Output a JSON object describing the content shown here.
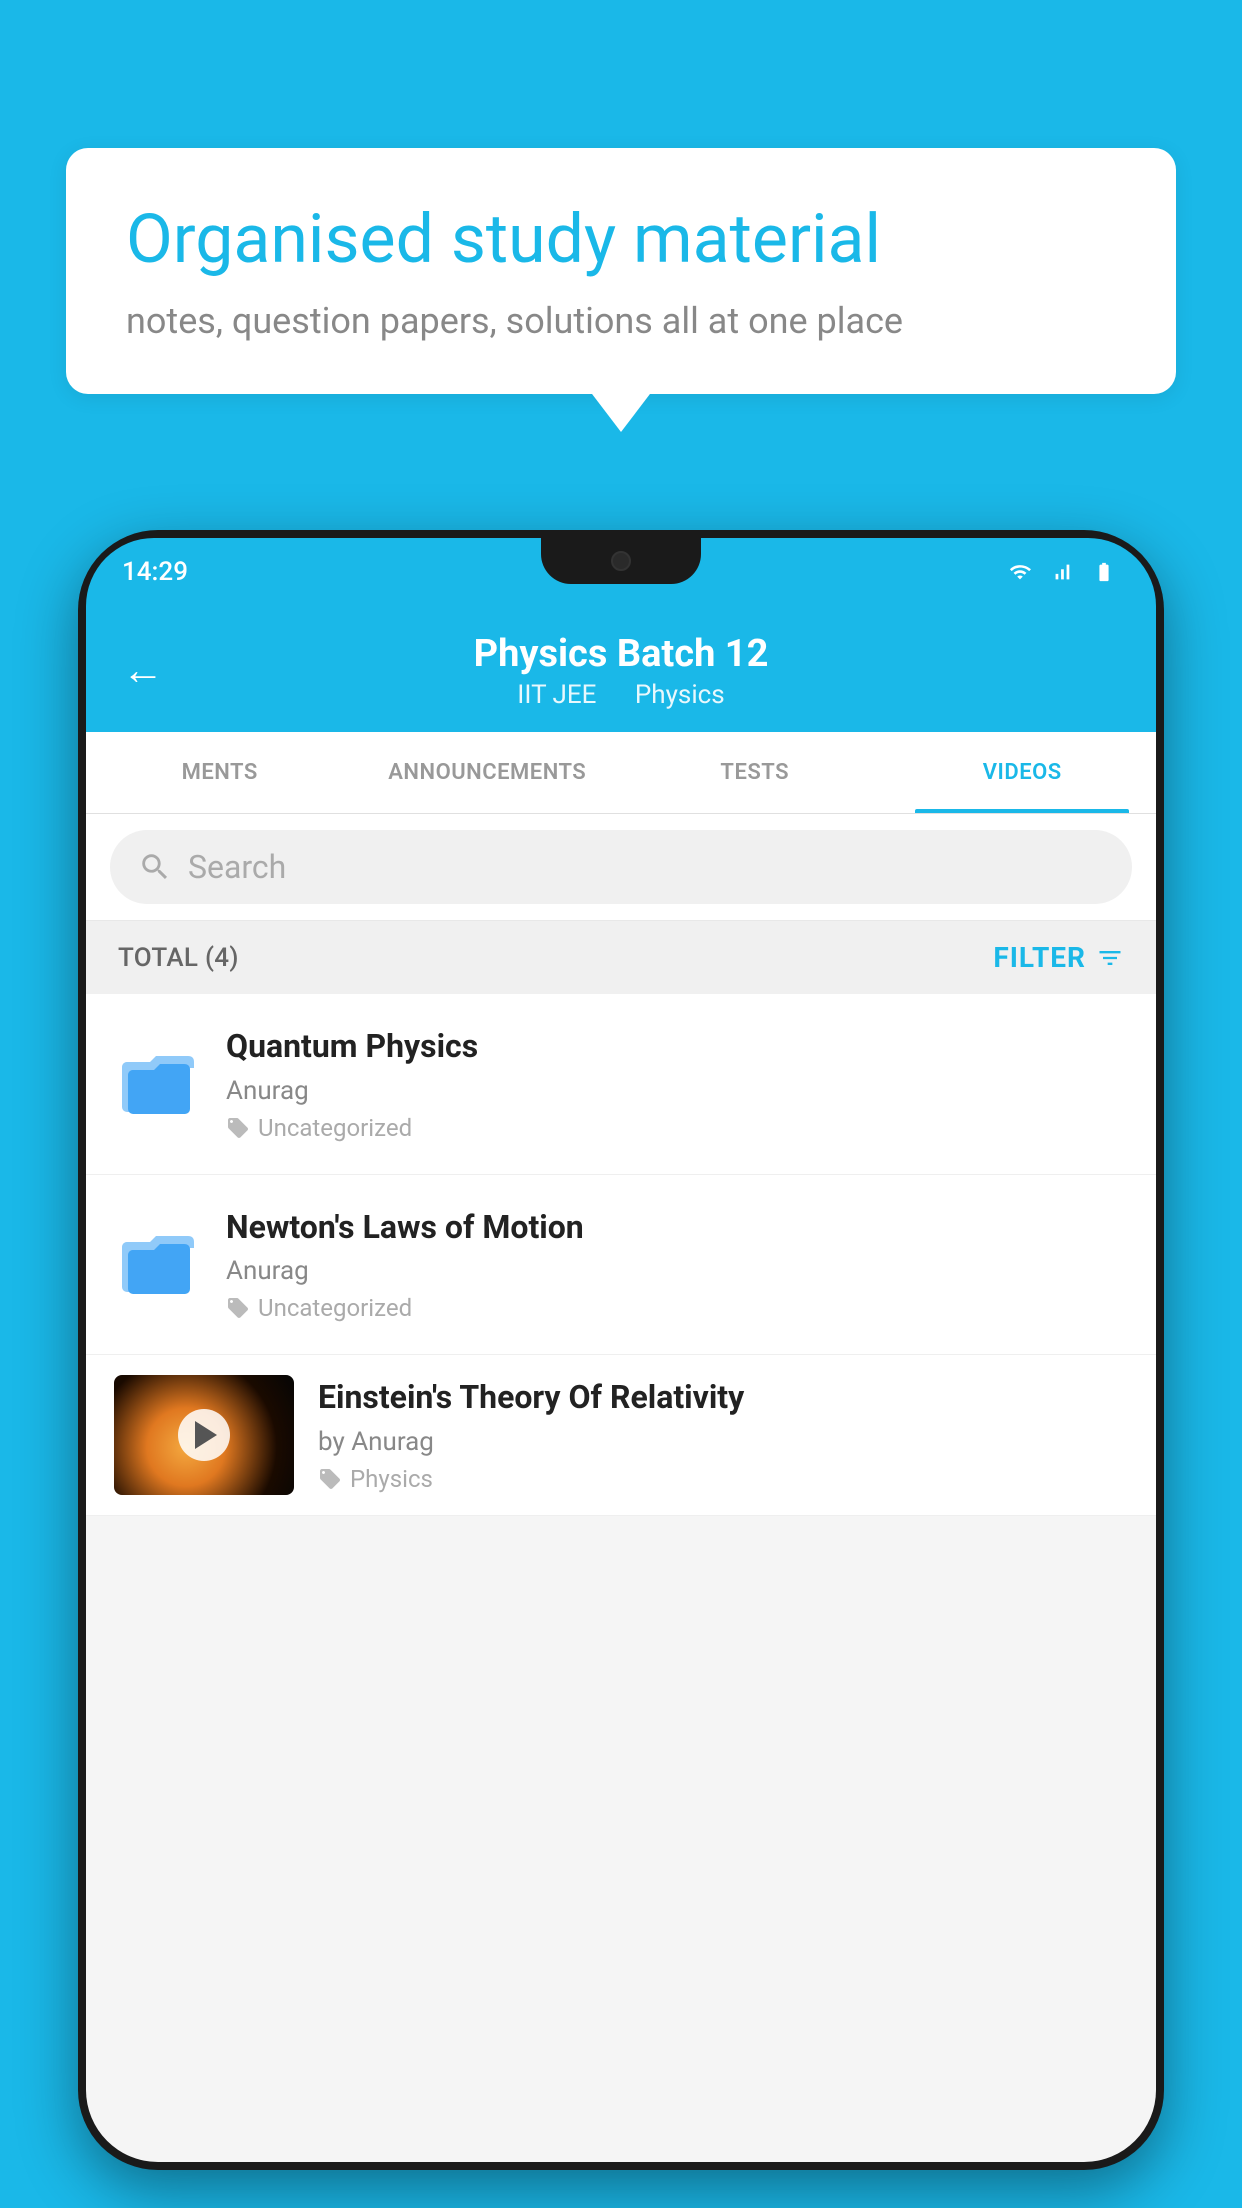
{
  "background_color": "#1ab8e8",
  "speech_bubble": {
    "title": "Organised study material",
    "subtitle": "notes, question papers, solutions all at one place"
  },
  "phone": {
    "status_bar": {
      "time": "14:29"
    },
    "header": {
      "title": "Physics Batch 12",
      "subtitle_part1": "IIT JEE",
      "subtitle_part2": "Physics",
      "back_label": "←"
    },
    "tabs": [
      {
        "label": "MENTS",
        "active": false
      },
      {
        "label": "ANNOUNCEMENTS",
        "active": false
      },
      {
        "label": "TESTS",
        "active": false
      },
      {
        "label": "VIDEOS",
        "active": true
      }
    ],
    "search": {
      "placeholder": "Search"
    },
    "filter_bar": {
      "total_label": "TOTAL (4)",
      "filter_label": "FILTER"
    },
    "videos": [
      {
        "id": "quantum",
        "title": "Quantum Physics",
        "author": "Anurag",
        "tag": "Uncategorized",
        "has_thumbnail": false
      },
      {
        "id": "newton",
        "title": "Newton's Laws of Motion",
        "author": "Anurag",
        "tag": "Uncategorized",
        "has_thumbnail": false
      },
      {
        "id": "einstein",
        "title": "Einstein's Theory Of Relativity",
        "author": "by Anurag",
        "tag": "Physics",
        "has_thumbnail": true
      }
    ]
  }
}
